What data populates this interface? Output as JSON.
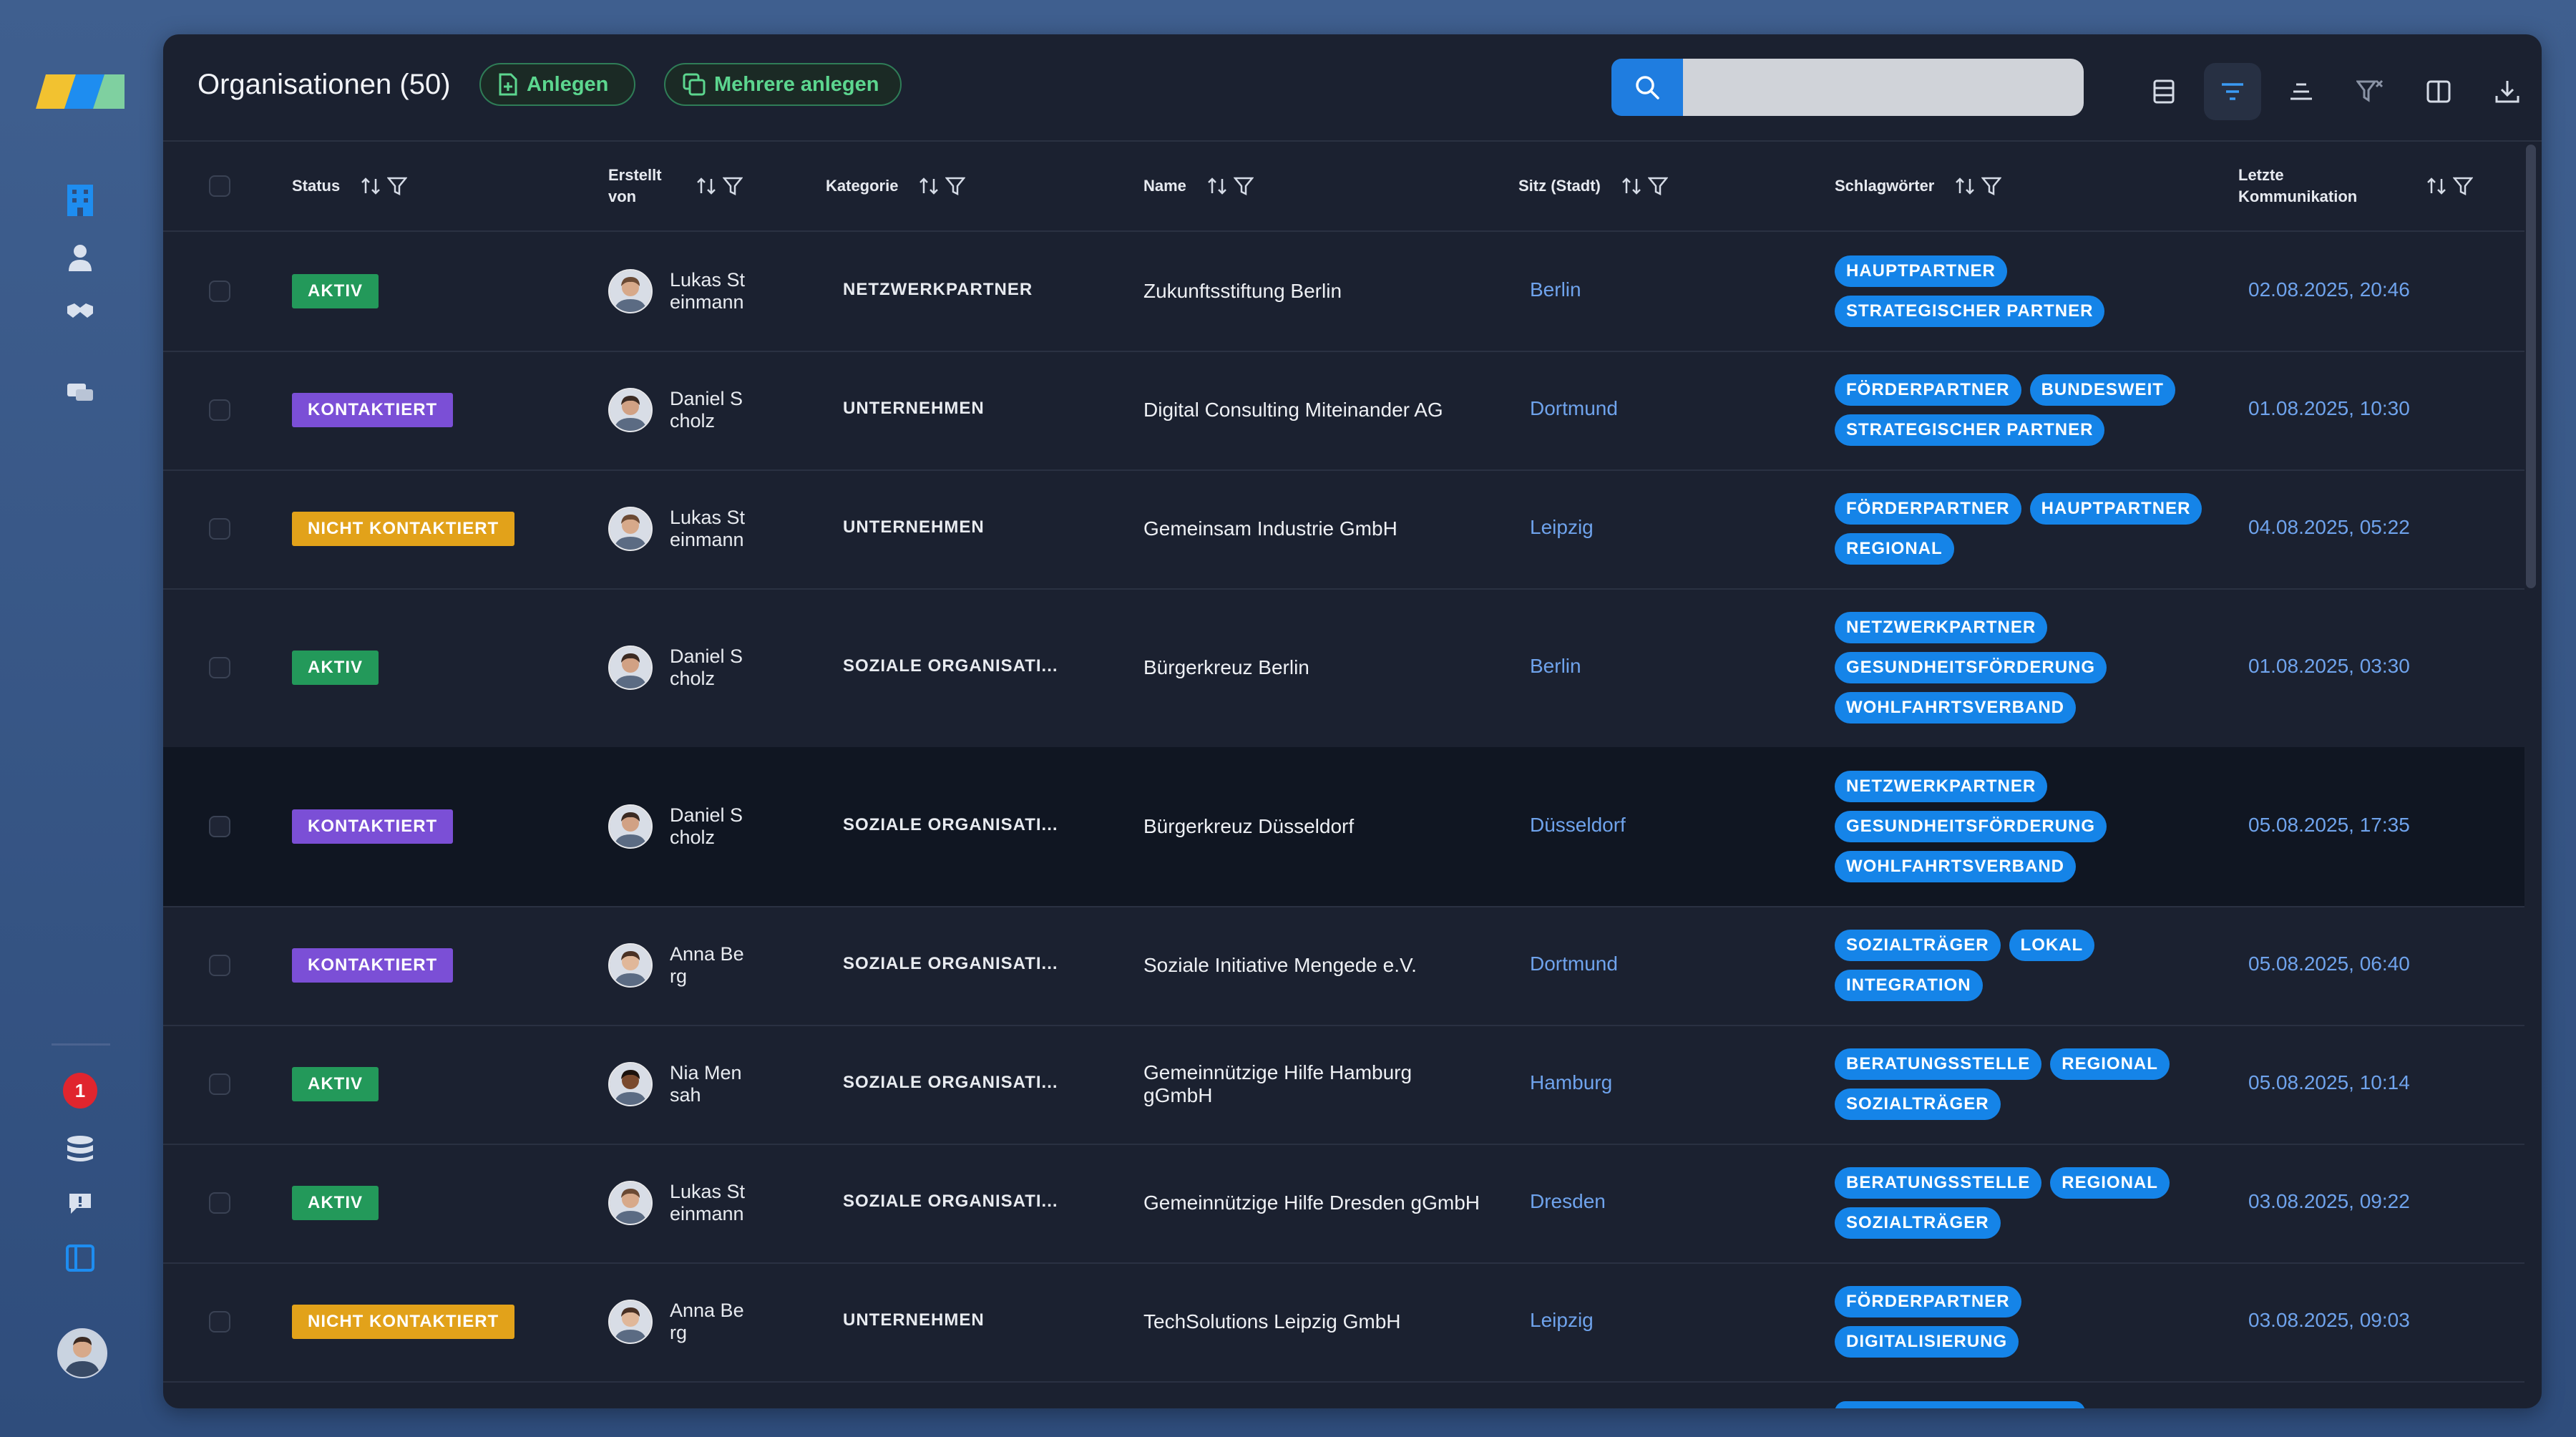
{
  "rail": {
    "notification_count": "1",
    "icons": [
      "building-icon",
      "person-icon",
      "handshake-icon",
      "chat-icon",
      "database-icon",
      "feedback-icon",
      "sidebar-toggle-icon"
    ]
  },
  "toolbar": {
    "title": "Organisationen (50)",
    "create_label": "Anlegen",
    "create_multiple_label": "Mehrere anlegen",
    "search_placeholder": "",
    "search_value": ""
  },
  "columns": {
    "status": "Status",
    "created_by": "Erstellt von",
    "category": "Kategorie",
    "name": "Name",
    "city": "Sitz (Stadt)",
    "tags": "Schlagwörter",
    "last_comm": "Letzte Kommunikation"
  },
  "colors": {
    "aktiv": "#23995a",
    "kontaktiert": "#7b4fd6",
    "nicht_kontaktiert": "#e2a21a",
    "tag": "#1584e8",
    "link": "#6fa3ec"
  },
  "rows": [
    {
      "status": "AKTIV",
      "status_key": "aktiv",
      "person": "Lukas Steinmann",
      "category": "NETZWERKPARTNER",
      "name": "Zukunftsstiftung Berlin",
      "city": "Berlin",
      "tags": [
        "HAUPTPARTNER",
        "STRATEGISCHER PARTNER"
      ],
      "date": "02.08.2025, 20:46"
    },
    {
      "status": "KONTAKTIERT",
      "status_key": "kontaktiert",
      "person": "Daniel Scholz",
      "category": "UNTERNEHMEN",
      "name": "Digital Consulting Miteinander AG",
      "city": "Dortmund",
      "tags": [
        "FÖRDERPARTNER",
        "BUNDESWEIT",
        "STRATEGISCHER PARTNER"
      ],
      "date": "01.08.2025, 10:30"
    },
    {
      "status": "NICHT KONTAKTIERT",
      "status_key": "nicht",
      "person": "Lukas Steinmann",
      "category": "UNTERNEHMEN",
      "name": "Gemeinsam Industrie GmbH",
      "city": "Leipzig",
      "tags": [
        "FÖRDERPARTNER",
        "HAUPTPARTNER",
        "REGIONAL"
      ],
      "date": "04.08.2025, 05:22"
    },
    {
      "status": "AKTIV",
      "status_key": "aktiv",
      "person": "Daniel Scholz",
      "category": "SOZIALE ORGANISATI...",
      "name": "Bürgerkreuz Berlin",
      "city": "Berlin",
      "tags": [
        "NETZWERKPARTNER",
        "GESUNDHEITSFÖRDERUNG",
        "WOHLFAHRTSVERBAND"
      ],
      "date": "01.08.2025, 03:30"
    },
    {
      "status": "KONTAKTIERT",
      "status_key": "kontaktiert",
      "person": "Daniel Scholz",
      "category": "SOZIALE ORGANISATI...",
      "name": "Bürgerkreuz Düsseldorf",
      "city": "Düsseldorf",
      "tags": [
        "NETZWERKPARTNER",
        "GESUNDHEITSFÖRDERUNG",
        "WOHLFAHRTSVERBAND"
      ],
      "date": "05.08.2025, 17:35"
    },
    {
      "status": "KONTAKTIERT",
      "status_key": "kontaktiert",
      "person": "Anna Berg",
      "category": "SOZIALE ORGANISATI...",
      "name": "Soziale Initiative Mengede e.V.",
      "city": "Dortmund",
      "tags": [
        "SOZIALTRÄGER",
        "LOKAL",
        "INTEGRATION"
      ],
      "date": "05.08.2025, 06:40"
    },
    {
      "status": "AKTIV",
      "status_key": "aktiv",
      "person": "Nia Mensah",
      "category": "SOZIALE ORGANISATI...",
      "name": "Gemeinnützige Hilfe Hamburg gGmbH",
      "city": "Hamburg",
      "tags": [
        "BERATUNGSSTELLE",
        "REGIONAL",
        "SOZIALTRÄGER"
      ],
      "date": "05.08.2025, 10:14"
    },
    {
      "status": "AKTIV",
      "status_key": "aktiv",
      "person": "Lukas Steinmann",
      "category": "SOZIALE ORGANISATI...",
      "name": "Gemeinnützige Hilfe Dresden gGmbH",
      "city": "Dresden",
      "tags": [
        "BERATUNGSSTELLE",
        "REGIONAL",
        "SOZIALTRÄGER"
      ],
      "date": "03.08.2025, 09:22"
    },
    {
      "status": "NICHT KONTAKTIERT",
      "status_key": "nicht",
      "person": "Anna Berg",
      "category": "UNTERNEHMEN",
      "name": "TechSolutions Leipzig GmbH",
      "city": "Leipzig",
      "tags": [
        "FÖRDERPARTNER",
        "DIGITALISIERUNG"
      ],
      "date": "03.08.2025, 09:03"
    }
  ]
}
